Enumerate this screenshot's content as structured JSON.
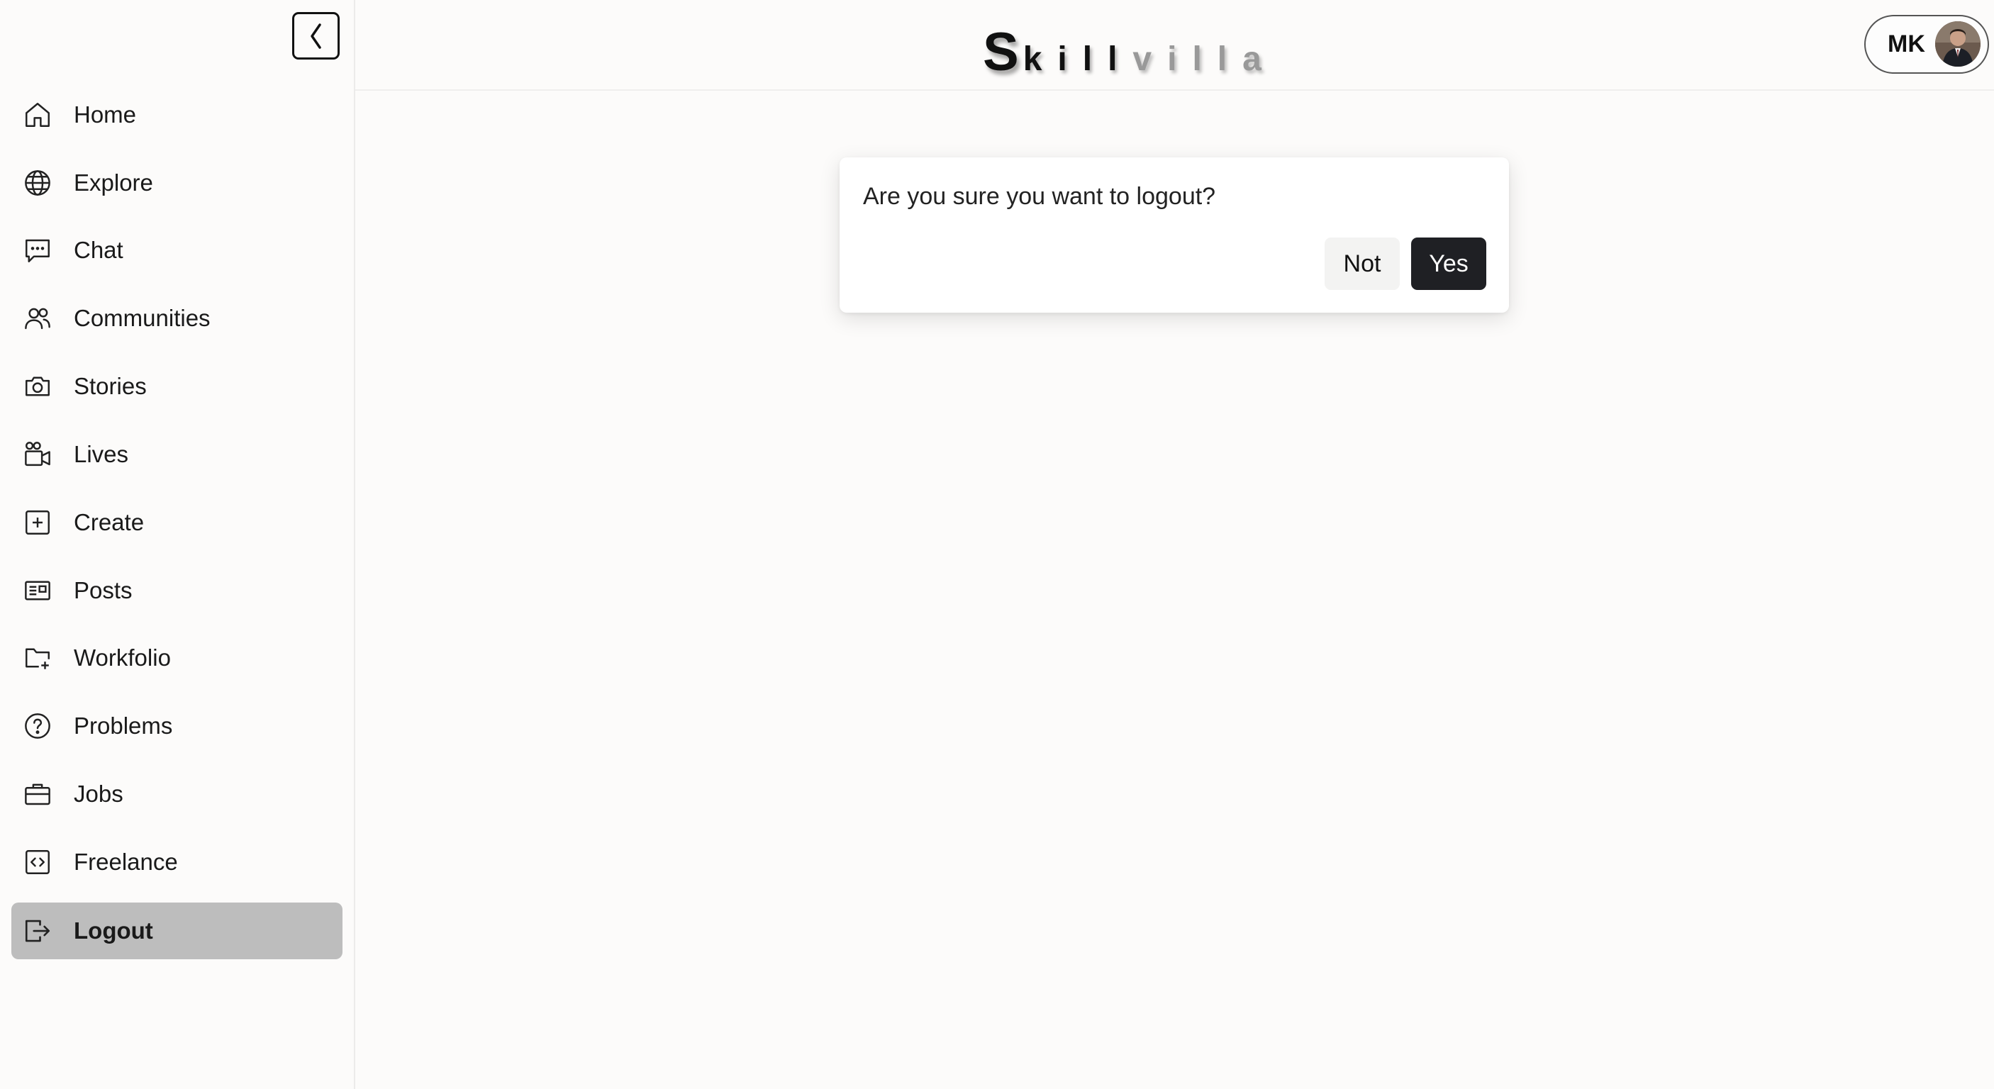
{
  "sidebar": {
    "collapse_icon": "chevron-left-icon",
    "items": [
      {
        "label": "Home",
        "icon": "home-icon"
      },
      {
        "label": "Explore",
        "icon": "globe-icon"
      },
      {
        "label": "Chat",
        "icon": "chat-icon"
      },
      {
        "label": "Communities",
        "icon": "users-icon"
      },
      {
        "label": "Stories",
        "icon": "camera-icon"
      },
      {
        "label": "Lives",
        "icon": "video-icon"
      },
      {
        "label": "Create",
        "icon": "plus-square-icon"
      },
      {
        "label": "Posts",
        "icon": "newspaper-icon"
      },
      {
        "label": "Workfolio",
        "icon": "folder-plus-icon"
      },
      {
        "label": "Problems",
        "icon": "question-circle-icon"
      },
      {
        "label": "Jobs",
        "icon": "briefcase-icon"
      },
      {
        "label": "Freelance",
        "icon": "code-square-icon"
      },
      {
        "label": "Logout",
        "icon": "logout-icon",
        "active": true
      }
    ],
    "active_color": "#bdbdbd"
  },
  "header": {
    "logo": {
      "first": "S",
      "dark": "kill",
      "light": "villa"
    },
    "profile": {
      "initials": "MK",
      "avatar": "user-avatar-photo"
    }
  },
  "dialog": {
    "message": "Are you sure you want to logout?",
    "cancel_label": "Not",
    "confirm_label": "Yes",
    "confirm_color": "#1f2024"
  }
}
